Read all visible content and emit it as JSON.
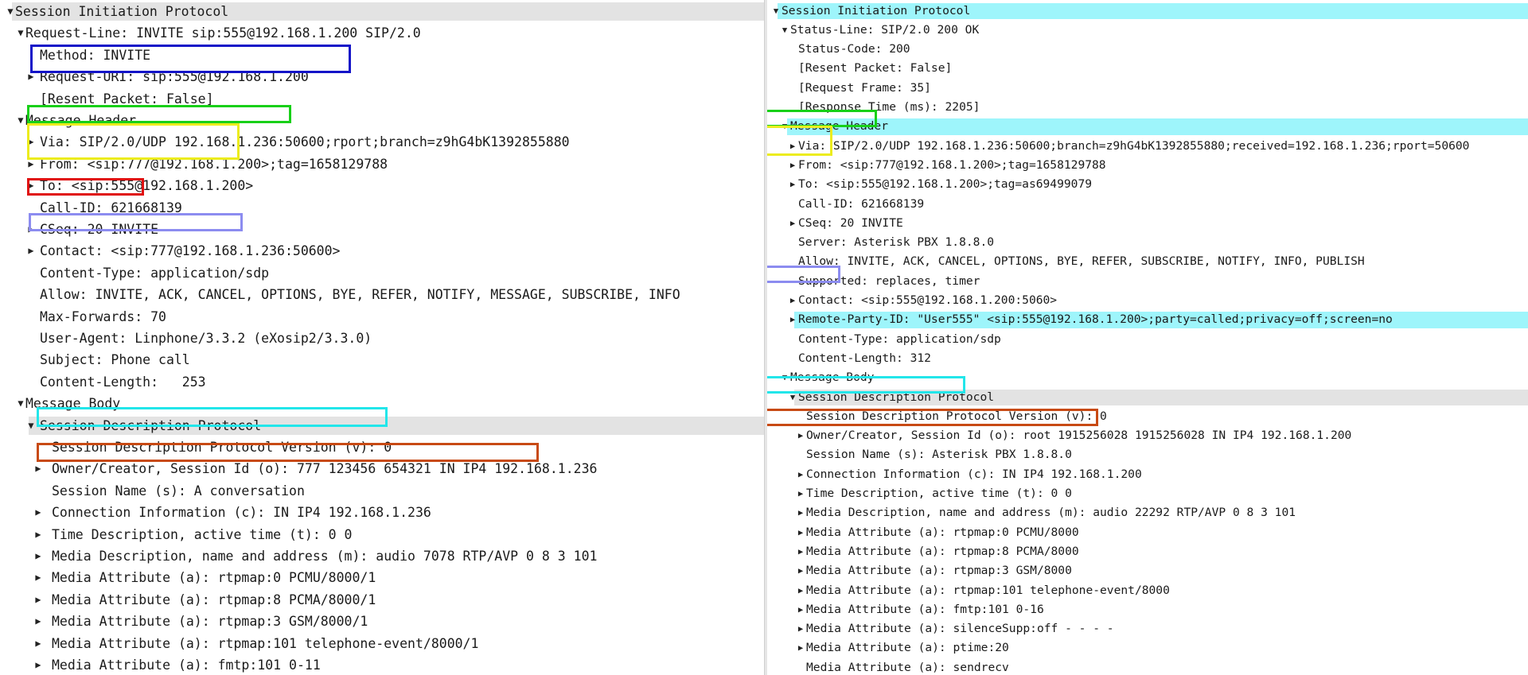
{
  "colors": {
    "box_blue": "#1414c8",
    "box_green": "#18d018",
    "box_yellow": "#ecec1e",
    "box_red": "#e01010",
    "box_lavender": "#8c8cf0",
    "box_cyan": "#22e6ea",
    "box_orange": "#c84a14",
    "row_highlight_gray": "#e3e3e3",
    "row_highlight_cyan": "#9ef5fb",
    "link": "#0000ee"
  },
  "left_tree": [
    {
      "indent": 0,
      "toggle": "expanded",
      "text": "Session Initiation Protocol",
      "hl": "gray"
    },
    {
      "indent": 1,
      "toggle": "expanded",
      "text": "Request-Line: INVITE sip:555@192.168.1.200 SIP/2.0"
    },
    {
      "indent": 2,
      "toggle": "none",
      "text": "Method: INVITE"
    },
    {
      "indent": 2,
      "toggle": "collapsed",
      "text": "Request-URI: sip:555@192.168.1.200"
    },
    {
      "indent": 2,
      "toggle": "none",
      "text": "[Resent Packet: False]"
    },
    {
      "indent": 1,
      "toggle": "expanded",
      "text": "Message Header"
    },
    {
      "indent": 2,
      "toggle": "collapsed",
      "text": "Via: SIP/2.0/UDP 192.168.1.236:50600;rport;branch=z9hG4bK1392855880"
    },
    {
      "indent": 2,
      "toggle": "collapsed",
      "text": "From: <sip:777@192.168.1.200>;tag=1658129788"
    },
    {
      "indent": 2,
      "toggle": "collapsed",
      "text": "To: <sip:555@192.168.1.200>"
    },
    {
      "indent": 2,
      "toggle": "none",
      "text": "Call-ID: 621668139"
    },
    {
      "indent": 2,
      "toggle": "collapsed",
      "text": "CSeq: 20 INVITE"
    },
    {
      "indent": 2,
      "toggle": "collapsed",
      "text": "Contact: <sip:777@192.168.1.236:50600>"
    },
    {
      "indent": 2,
      "toggle": "none",
      "text": "Content-Type: application/sdp"
    },
    {
      "indent": 2,
      "toggle": "none",
      "text": "Allow: INVITE, ACK, CANCEL, OPTIONS, BYE, REFER, NOTIFY, MESSAGE, SUBSCRIBE, INFO"
    },
    {
      "indent": 2,
      "toggle": "none",
      "text": "Max-Forwards: 70"
    },
    {
      "indent": 2,
      "toggle": "none",
      "text": "User-Agent: Linphone/3.3.2 (eXosip2/3.3.0)"
    },
    {
      "indent": 2,
      "toggle": "none",
      "text": "Subject: Phone call"
    },
    {
      "indent": 2,
      "toggle": "none",
      "text": "Content-Length:   253"
    },
    {
      "indent": 1,
      "toggle": "expanded",
      "text": "Message Body"
    },
    {
      "indent": 2,
      "toggle": "expanded",
      "text": "Session Description Protocol",
      "hl": "gray"
    },
    {
      "indent": 3,
      "toggle": "none",
      "text": "Session Description Protocol Version (v): 0"
    },
    {
      "indent": 3,
      "toggle": "collapsed",
      "text": "Owner/Creator, Session Id (o): 777 123456 654321 IN IP4 192.168.1.236"
    },
    {
      "indent": 3,
      "toggle": "none",
      "text": "Session Name (s): A conversation"
    },
    {
      "indent": 3,
      "toggle": "collapsed",
      "text": "Connection Information (c): IN IP4 192.168.1.236"
    },
    {
      "indent": 3,
      "toggle": "collapsed",
      "text": "Time Description, active time (t): 0 0"
    },
    {
      "indent": 3,
      "toggle": "collapsed",
      "text": "Media Description, name and address (m): audio 7078 RTP/AVP 0 8 3 101"
    },
    {
      "indent": 3,
      "toggle": "collapsed",
      "text": "Media Attribute (a): rtpmap:0 PCMU/8000/1"
    },
    {
      "indent": 3,
      "toggle": "collapsed",
      "text": "Media Attribute (a): rtpmap:8 PCMA/8000/1"
    },
    {
      "indent": 3,
      "toggle": "collapsed",
      "text": "Media Attribute (a): rtpmap:3 GSM/8000/1"
    },
    {
      "indent": 3,
      "toggle": "collapsed",
      "text": "Media Attribute (a): rtpmap:101 telephone-event/8000/1"
    },
    {
      "indent": 3,
      "toggle": "collapsed",
      "text": "Media Attribute (a): fmtp:101 0-11"
    }
  ],
  "right_tree": [
    {
      "indent": 0,
      "toggle": "expanded",
      "text": "Session Initiation Protocol",
      "hl": "cyan"
    },
    {
      "indent": 1,
      "toggle": "expanded",
      "text": "Status-Line: SIP/2.0 200 OK"
    },
    {
      "indent": 2,
      "toggle": "none",
      "text": "Status-Code: 200"
    },
    {
      "indent": 2,
      "toggle": "none",
      "text": "[Resent Packet: False]"
    },
    {
      "indent": 2,
      "toggle": "none",
      "text": "[Request Frame: 35]",
      "link": true
    },
    {
      "indent": 2,
      "toggle": "none",
      "text": "[Response Time (ms): 2205]"
    },
    {
      "indent": 1,
      "toggle": "expanded",
      "text": "Message Header",
      "hl": "cyan"
    },
    {
      "indent": 2,
      "toggle": "collapsed",
      "text": "Via: SIP/2.0/UDP 192.168.1.236:50600;branch=z9hG4bK1392855880;received=192.168.1.236;rport=50600"
    },
    {
      "indent": 2,
      "toggle": "collapsed",
      "text": "From: <sip:777@192.168.1.200>;tag=1658129788"
    },
    {
      "indent": 2,
      "toggle": "collapsed",
      "text": "To: <sip:555@192.168.1.200>;tag=as69499079"
    },
    {
      "indent": 2,
      "toggle": "none",
      "text": "Call-ID: 621668139"
    },
    {
      "indent": 2,
      "toggle": "collapsed",
      "text": "CSeq: 20 INVITE"
    },
    {
      "indent": 2,
      "toggle": "none",
      "text": "Server: Asterisk PBX 1.8.8.0"
    },
    {
      "indent": 2,
      "toggle": "none",
      "text": "Allow: INVITE, ACK, CANCEL, OPTIONS, BYE, REFER, SUBSCRIBE, NOTIFY, INFO, PUBLISH"
    },
    {
      "indent": 2,
      "toggle": "none",
      "text": "Supported: replaces, timer"
    },
    {
      "indent": 2,
      "toggle": "collapsed",
      "text": "Contact: <sip:555@192.168.1.200:5060>"
    },
    {
      "indent": 2,
      "toggle": "collapsed",
      "text": "Remote-Party-ID: \"User555\" <sip:555@192.168.1.200>;party=called;privacy=off;screen=no",
      "hl": "cyan"
    },
    {
      "indent": 2,
      "toggle": "none",
      "text": "Content-Type: application/sdp"
    },
    {
      "indent": 2,
      "toggle": "none",
      "text": "Content-Length: 312"
    },
    {
      "indent": 1,
      "toggle": "expanded",
      "text": "Message Body"
    },
    {
      "indent": 2,
      "toggle": "expanded",
      "text": "Session Description Protocol",
      "hl": "gray"
    },
    {
      "indent": 3,
      "toggle": "none",
      "text": "Session Description Protocol Version (v): 0"
    },
    {
      "indent": 3,
      "toggle": "collapsed",
      "text": "Owner/Creator, Session Id (o): root 1915256028 1915256028 IN IP4 192.168.1.200"
    },
    {
      "indent": 3,
      "toggle": "none",
      "text": "Session Name (s): Asterisk PBX 1.8.8.0"
    },
    {
      "indent": 3,
      "toggle": "collapsed",
      "text": "Connection Information (c): IN IP4 192.168.1.200"
    },
    {
      "indent": 3,
      "toggle": "collapsed",
      "text": "Time Description, active time (t): 0 0"
    },
    {
      "indent": 3,
      "toggle": "collapsed",
      "text": "Media Description, name and address (m): audio 22292 RTP/AVP 0 8 3 101"
    },
    {
      "indent": 3,
      "toggle": "collapsed",
      "text": "Media Attribute (a): rtpmap:0 PCMU/8000"
    },
    {
      "indent": 3,
      "toggle": "collapsed",
      "text": "Media Attribute (a): rtpmap:8 PCMA/8000"
    },
    {
      "indent": 3,
      "toggle": "collapsed",
      "text": "Media Attribute (a): rtpmap:3 GSM/8000"
    },
    {
      "indent": 3,
      "toggle": "collapsed",
      "text": "Media Attribute (a): rtpmap:101 telephone-event/8000"
    },
    {
      "indent": 3,
      "toggle": "collapsed",
      "text": "Media Attribute (a): fmtp:101 0-16"
    },
    {
      "indent": 3,
      "toggle": "collapsed",
      "text": "Media Attribute (a): silenceSupp:off - - - -"
    },
    {
      "indent": 3,
      "toggle": "collapsed",
      "text": "Media Attribute (a): ptime:20"
    },
    {
      "indent": 3,
      "toggle": "none",
      "text": "Media Attribute (a): sendrecv"
    }
  ]
}
